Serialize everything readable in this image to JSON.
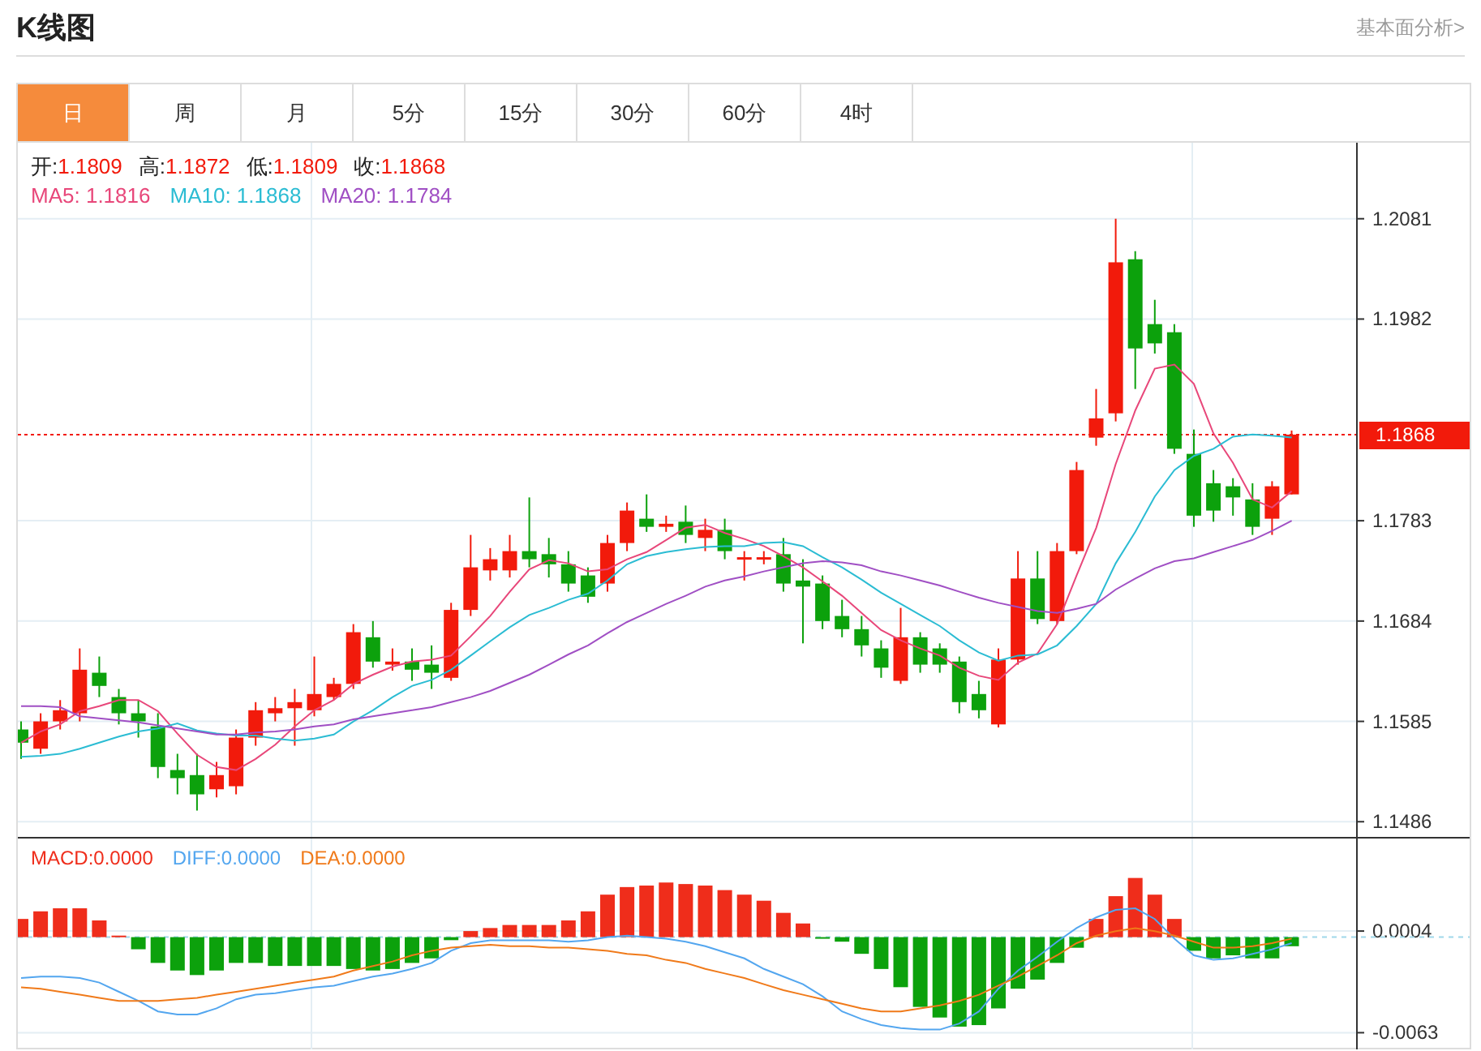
{
  "header": {
    "title": "K线图",
    "link": "基本面分析>"
  },
  "tabs": [
    {
      "label": "日",
      "selected": true
    },
    {
      "label": "周",
      "selected": false
    },
    {
      "label": "月",
      "selected": false
    },
    {
      "label": "5分",
      "selected": false
    },
    {
      "label": "15分",
      "selected": false
    },
    {
      "label": "30分",
      "selected": false
    },
    {
      "label": "60分",
      "selected": false
    },
    {
      "label": "4时",
      "selected": false
    }
  ],
  "quote": [
    {
      "label": "开:",
      "value": "1.1809"
    },
    {
      "label": "高:",
      "value": "1.1872"
    },
    {
      "label": "低:",
      "value": "1.1809"
    },
    {
      "label": "收:",
      "value": "1.1868"
    }
  ],
  "main_chart": {
    "legend_values": [
      ": 1.1816",
      ": 1.1868",
      ": 1.1784"
    ],
    "chart_data": {
      "type": "candlestick",
      "grid": true,
      "ylim": [
        1.1471,
        1.2156
      ],
      "yticks": [
        1.2081,
        1.1982,
        1.1783,
        1.1684,
        1.1585,
        1.1486
      ],
      "ref_lines": [
        {
          "axis": "y",
          "value": 1.1868,
          "label": "1.1868",
          "color": "#f21a0b"
        }
      ],
      "ohlc": [
        [
          1.1577,
          1.1585,
          1.1548,
          1.1564
        ],
        [
          1.1558,
          1.1593,
          1.1553,
          1.1585
        ],
        [
          1.1585,
          1.1606,
          1.1577,
          1.1596
        ],
        [
          1.1593,
          1.1657,
          1.1585,
          1.1636
        ],
        [
          1.1633,
          1.1649,
          1.1609,
          1.162
        ],
        [
          1.1609,
          1.1617,
          1.1582,
          1.1593
        ],
        [
          1.1593,
          1.1606,
          1.1569,
          1.1585
        ],
        [
          1.158,
          1.1593,
          1.1529,
          1.154
        ],
        [
          1.1537,
          1.1553,
          1.1513,
          1.1529
        ],
        [
          1.1532,
          1.1553,
          1.1497,
          1.1513
        ],
        [
          1.1518,
          1.1545,
          1.151,
          1.1532
        ],
        [
          1.1521,
          1.1577,
          1.1513,
          1.1569
        ],
        [
          1.1569,
          1.1604,
          1.1561,
          1.1596
        ],
        [
          1.1593,
          1.1609,
          1.1585,
          1.1598
        ],
        [
          1.1598,
          1.1617,
          1.1561,
          1.1604
        ],
        [
          1.1596,
          1.1649,
          1.159,
          1.1612
        ],
        [
          1.1609,
          1.1628,
          1.1606,
          1.1622
        ],
        [
          1.1622,
          1.1681,
          1.1617,
          1.1673
        ],
        [
          1.1668,
          1.1684,
          1.1638,
          1.1644
        ],
        [
          1.1641,
          1.1657,
          1.1635,
          1.1644
        ],
        [
          1.1644,
          1.1657,
          1.1625,
          1.1636
        ],
        [
          1.1641,
          1.166,
          1.1617,
          1.1633
        ],
        [
          1.1628,
          1.1702,
          1.1625,
          1.1695
        ],
        [
          1.1695,
          1.1769,
          1.1689,
          1.1737
        ],
        [
          1.1734,
          1.1756,
          1.1724,
          1.1745
        ],
        [
          1.1734,
          1.1769,
          1.1727,
          1.1753
        ],
        [
          1.1753,
          1.1806,
          1.1737,
          1.1745
        ],
        [
          1.175,
          1.1766,
          1.1727,
          1.174
        ],
        [
          1.174,
          1.1753,
          1.1713,
          1.1721
        ],
        [
          1.1729,
          1.1737,
          1.1702,
          1.1708
        ],
        [
          1.1721,
          1.1769,
          1.1713,
          1.1761
        ],
        [
          1.1761,
          1.1801,
          1.1753,
          1.1793
        ],
        [
          1.1785,
          1.1809,
          1.1772,
          1.1777
        ],
        [
          1.1777,
          1.1788,
          1.1772,
          1.178
        ],
        [
          1.1782,
          1.1798,
          1.1761,
          1.1769
        ],
        [
          1.1766,
          1.1785,
          1.1753,
          1.1774
        ],
        [
          1.1774,
          1.1785,
          1.1745,
          1.1753
        ],
        [
          1.1745,
          1.1753,
          1.1724,
          1.1747
        ],
        [
          1.1745,
          1.1753,
          1.174,
          1.1747
        ],
        [
          1.175,
          1.1766,
          1.1713,
          1.1721
        ],
        [
          1.1724,
          1.1745,
          1.1662,
          1.1718
        ],
        [
          1.1721,
          1.1729,
          1.1676,
          1.1684
        ],
        [
          1.1689,
          1.1705,
          1.1668,
          1.1676
        ],
        [
          1.1676,
          1.1689,
          1.1649,
          1.166
        ],
        [
          1.1657,
          1.1665,
          1.1628,
          1.1638
        ],
        [
          1.1625,
          1.1697,
          1.1622,
          1.1668
        ],
        [
          1.1668,
          1.1673,
          1.1633,
          1.1641
        ],
        [
          1.1657,
          1.1662,
          1.1633,
          1.1641
        ],
        [
          1.1644,
          1.1649,
          1.1593,
          1.1604
        ],
        [
          1.1612,
          1.1625,
          1.1588,
          1.1596
        ],
        [
          1.1582,
          1.1657,
          1.1579,
          1.1646
        ],
        [
          1.1646,
          1.1753,
          1.1641,
          1.1726
        ],
        [
          1.1726,
          1.1753,
          1.1681,
          1.1686
        ],
        [
          1.1684,
          1.1761,
          1.1681,
          1.1753
        ],
        [
          1.1753,
          1.1841,
          1.175,
          1.1833
        ],
        [
          1.1865,
          1.1913,
          1.1857,
          1.1884
        ],
        [
          1.1889,
          1.2081,
          1.1881,
          1.2038
        ],
        [
          1.2041,
          1.2049,
          1.1913,
          1.1953
        ],
        [
          1.1977,
          1.2001,
          1.1948,
          1.1958
        ],
        [
          1.1969,
          1.1977,
          1.1849,
          1.1854
        ],
        [
          1.1849,
          1.1873,
          1.1777,
          1.1788
        ],
        [
          1.182,
          1.1833,
          1.1782,
          1.1793
        ],
        [
          1.1817,
          1.1825,
          1.1788,
          1.1806
        ],
        [
          1.1804,
          1.182,
          1.1769,
          1.1777
        ],
        [
          1.1785,
          1.1822,
          1.1769,
          1.1817
        ],
        [
          1.1809,
          1.1872,
          1.1809,
          1.1868
        ]
      ],
      "series": [
        {
          "name": "MA5",
          "color": "#e8477a",
          "type": "line",
          "values": [
            1.1564,
            1.1575,
            1.1582,
            1.1595,
            1.16,
            1.1606,
            1.1606,
            1.1595,
            1.1573,
            1.1552,
            1.154,
            1.1537,
            1.1548,
            1.1562,
            1.158,
            1.1596,
            1.1606,
            1.1622,
            1.1631,
            1.1639,
            1.1644,
            1.1646,
            1.165,
            1.1669,
            1.1689,
            1.1713,
            1.1735,
            1.1744,
            1.1741,
            1.1733,
            1.1735,
            1.1745,
            1.1752,
            1.1764,
            1.1776,
            1.1779,
            1.1771,
            1.1765,
            1.1758,
            1.1748,
            1.1737,
            1.1723,
            1.1709,
            1.1692,
            1.1675,
            1.1665,
            1.1657,
            1.165,
            1.1638,
            1.163,
            1.1626,
            1.1643,
            1.1652,
            1.1681,
            1.1729,
            1.1776,
            1.1839,
            1.1892,
            1.1933,
            1.1937,
            1.1918,
            1.1869,
            1.184,
            1.1804,
            1.1796,
            1.1812
          ]
        },
        {
          "name": "MA10",
          "color": "#2bbcd3",
          "type": "line",
          "values": [
            1.155,
            1.1551,
            1.1553,
            1.1558,
            1.1564,
            1.157,
            1.1575,
            1.1578,
            1.1583,
            1.1576,
            1.1573,
            1.1571,
            1.1571,
            1.1568,
            1.1566,
            1.1568,
            1.1572,
            1.1585,
            1.1596,
            1.1609,
            1.162,
            1.1626,
            1.1636,
            1.165,
            1.1664,
            1.1678,
            1.169,
            1.1697,
            1.1705,
            1.1711,
            1.1724,
            1.174,
            1.1748,
            1.1752,
            1.1755,
            1.1757,
            1.1758,
            1.1758,
            1.1761,
            1.1762,
            1.1758,
            1.1747,
            1.1737,
            1.1725,
            1.1712,
            1.1701,
            1.169,
            1.1679,
            1.1665,
            1.1653,
            1.1645,
            1.165,
            1.1651,
            1.166,
            1.1679,
            1.1701,
            1.1741,
            1.1772,
            1.1807,
            1.1833,
            1.1847,
            1.1854,
            1.1866,
            1.1868,
            1.1867,
            1.1865
          ]
        },
        {
          "name": "MA20",
          "color": "#a04fc4",
          "type": "line",
          "values": [
            1.16,
            1.16,
            1.1599,
            1.159,
            1.1588,
            1.1586,
            1.1584,
            1.1581,
            1.1578,
            1.1575,
            1.1572,
            1.1572,
            1.1574,
            1.1575,
            1.1577,
            1.158,
            1.1582,
            1.1587,
            1.159,
            1.1593,
            1.1596,
            1.1599,
            1.1604,
            1.1609,
            1.1615,
            1.1623,
            1.1631,
            1.1641,
            1.1651,
            1.166,
            1.1672,
            1.1683,
            1.1692,
            1.1701,
            1.1709,
            1.1718,
            1.1724,
            1.1728,
            1.1733,
            1.1737,
            1.1741,
            1.1743,
            1.1742,
            1.1739,
            1.1733,
            1.1729,
            1.1724,
            1.1719,
            1.1713,
            1.1707,
            1.1702,
            1.1698,
            1.1694,
            1.1692,
            1.1696,
            1.1701,
            1.1715,
            1.1726,
            1.1736,
            1.1743,
            1.1746,
            1.1752,
            1.1758,
            1.1764,
            1.1773,
            1.1783
          ]
        }
      ]
    }
  },
  "macd_chart": {
    "legend_values": [
      ":0.0000",
      ":0.0000",
      ":0.0000"
    ],
    "chart_data": {
      "type": "bar",
      "grid": true,
      "ylim": [
        -0.0074,
        0.0065
      ],
      "yticks": [
        0.0004,
        -0.0063
      ],
      "ref_lines": [
        {
          "axis": "y",
          "value": 0,
          "color": "#9fd8ea"
        }
      ],
      "series": [
        {
          "name": "MACD",
          "color": "#ef2d1b",
          "values": [
            0.0012,
            0.0017,
            0.0019,
            0.0019,
            0.0011,
            0.0001,
            null,
            null,
            null,
            null,
            null,
            null,
            null,
            null,
            null,
            null,
            null,
            null,
            null,
            null,
            null,
            null,
            null,
            0.0004,
            0.0006,
            0.0008,
            0.0008,
            0.0008,
            0.0011,
            0.0017,
            0.0028,
            0.0033,
            0.0034,
            0.0036,
            0.0035,
            0.0034,
            0.0031,
            0.0028,
            0.0024,
            0.0016,
            0.0009,
            null,
            null,
            null,
            null,
            null,
            null,
            null,
            null,
            null,
            null,
            null,
            null,
            null,
            null,
            0.0012,
            0.0027,
            0.0039,
            0.0028,
            0.0012,
            null,
            null,
            null,
            null,
            null,
            null
          ]
        },
        {
          "name": "DIFF",
          "color": "#53a6ef",
          "type": "line",
          "values": [
            -0.0027,
            -0.0026,
            -0.0026,
            -0.0027,
            -0.003,
            -0.0036,
            -0.0042,
            -0.0049,
            -0.0051,
            -0.0051,
            -0.0047,
            -0.0041,
            -0.0038,
            -0.0037,
            -0.0035,
            -0.0033,
            -0.0032,
            -0.0029,
            -0.0026,
            -0.0024,
            -0.0021,
            -0.0017,
            -0.0009,
            -0.0004,
            -0.0002,
            -0.0002,
            -0.0002,
            -0.0002,
            -0.0003,
            -0.0002,
            0.0,
            0.0001,
            0.0,
            -0.0001,
            -0.0003,
            -0.0006,
            -0.001,
            -0.0014,
            -0.0021,
            -0.0026,
            -0.0031,
            -0.0039,
            -0.0049,
            -0.0054,
            -0.0058,
            -0.006,
            -0.0061,
            -0.0061,
            -0.0057,
            -0.0049,
            -0.0034,
            -0.0022,
            -0.0013,
            -0.0003,
            0.0006,
            0.0013,
            0.0018,
            0.0019,
            0.0012,
            -0.0001,
            -0.0012,
            -0.0015,
            -0.0014,
            -0.0011,
            -0.0008,
            -0.0004
          ]
        },
        {
          "name": "DEA",
          "color": "#f07a1a",
          "type": "line",
          "values": [
            -0.0033,
            -0.0034,
            -0.0036,
            -0.0038,
            -0.004,
            -0.0042,
            -0.0042,
            -0.0042,
            -0.0041,
            -0.004,
            -0.0038,
            -0.0036,
            -0.0034,
            -0.0032,
            -0.003,
            -0.0028,
            -0.0026,
            -0.0022,
            -0.0019,
            -0.0016,
            -0.0012,
            -0.0009,
            -0.0007,
            -0.0006,
            -0.0005,
            -0.0006,
            -0.0006,
            -0.0007,
            -0.0007,
            -0.0008,
            -0.0009,
            -0.0011,
            -0.0012,
            -0.0015,
            -0.0017,
            -0.0021,
            -0.0024,
            -0.0027,
            -0.0031,
            -0.0035,
            -0.0038,
            -0.0041,
            -0.0044,
            -0.0047,
            -0.0049,
            -0.0049,
            -0.0047,
            -0.0045,
            -0.0042,
            -0.0038,
            -0.0032,
            -0.0026,
            -0.0019,
            -0.0012,
            -0.0004,
            0.0001,
            0.0004,
            0.0006,
            0.0004,
            0.0001,
            -0.0003,
            -0.0007,
            -0.0007,
            -0.0006,
            -0.0004,
            -0.0001
          ]
        },
        {
          "color": "#0ca10c",
          "values": [
            null,
            null,
            null,
            null,
            null,
            null,
            -0.0008,
            -0.0017,
            -0.0022,
            -0.0025,
            -0.0022,
            -0.0017,
            -0.0017,
            -0.0019,
            -0.0019,
            -0.0019,
            -0.0019,
            -0.0021,
            -0.0022,
            -0.0021,
            -0.0017,
            -0.0014,
            -0.0002,
            null,
            null,
            null,
            null,
            null,
            null,
            null,
            null,
            null,
            null,
            null,
            null,
            null,
            null,
            null,
            null,
            null,
            null,
            -0.0001,
            -0.0003,
            -0.0011,
            -0.0021,
            -0.0033,
            -0.0046,
            -0.0053,
            -0.0059,
            -0.0058,
            -0.0047,
            -0.0034,
            -0.0028,
            -0.0017,
            -0.0007,
            null,
            null,
            null,
            null,
            null,
            -0.0009,
            -0.0014,
            -0.0012,
            -0.0014,
            -0.0014,
            -0.0006
          ]
        }
      ]
    }
  }
}
